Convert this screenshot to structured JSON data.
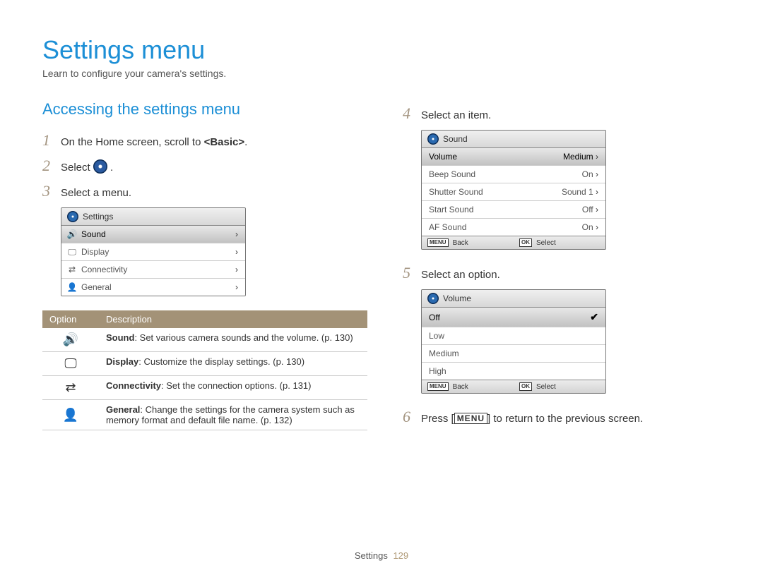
{
  "title": "Settings menu",
  "subtitle": "Learn to configure your camera's settings.",
  "section": "Accessing the settings menu",
  "steps": {
    "s1": "On the Home screen, scroll to <Basic>.",
    "s2": "Select",
    "s2_after": ".",
    "s3": "Select a menu.",
    "s4": "Select an item.",
    "s5": "Select an option.",
    "s6_a": "Press [",
    "s6_menu": "MENU",
    "s6_b": "] to return to the previous screen."
  },
  "panel_settings": {
    "header": "Settings",
    "rows": [
      {
        "icon": "ic-sound",
        "label": "Sound",
        "selected": true
      },
      {
        "icon": "ic-display",
        "label": "Display",
        "selected": false
      },
      {
        "icon": "ic-connect",
        "label": "Connectivity",
        "selected": false
      },
      {
        "icon": "ic-general",
        "label": "General",
        "selected": false
      }
    ]
  },
  "desc_table": {
    "head_option": "Option",
    "head_desc": "Description",
    "rows": [
      {
        "icon": "🔊",
        "bold": "Sound",
        "text": ": Set various camera sounds and the volume. (p. 130)"
      },
      {
        "icon": "🖵",
        "bold": "Display",
        "text": ": Customize the display settings. (p. 130)"
      },
      {
        "icon": "⇄",
        "bold": "Connectivity",
        "text": ": Set the connection options. (p. 131)"
      },
      {
        "icon": "👤",
        "bold": "General",
        "text": ": Change the settings for the camera system such as memory format and default file name. (p. 132)"
      }
    ]
  },
  "panel_sound": {
    "header": "Sound",
    "rows": [
      {
        "label": "Volume",
        "value": "Medium",
        "selected": true
      },
      {
        "label": "Beep Sound",
        "value": "On",
        "selected": false
      },
      {
        "label": "Shutter Sound",
        "value": "Sound 1",
        "selected": false
      },
      {
        "label": "Start Sound",
        "value": "Off",
        "selected": false
      },
      {
        "label": "AF Sound",
        "value": "On",
        "selected": false
      }
    ],
    "footer_menu": "MENU",
    "footer_back": "Back",
    "footer_ok": "OK",
    "footer_select": "Select"
  },
  "panel_volume": {
    "header": "Volume",
    "rows": [
      {
        "label": "Off",
        "checked": true
      },
      {
        "label": "Low",
        "checked": false
      },
      {
        "label": "Medium",
        "checked": false
      },
      {
        "label": "High",
        "checked": false
      }
    ],
    "footer_menu": "MENU",
    "footer_back": "Back",
    "footer_ok": "OK",
    "footer_select": "Select"
  },
  "footer": {
    "label": "Settings",
    "page": "129"
  }
}
